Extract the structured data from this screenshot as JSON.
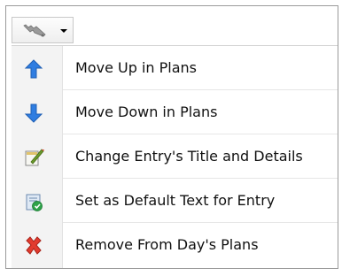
{
  "toolbar": {
    "button_icon": "wrench-icon",
    "dropdown_icon": "chevron-down-icon"
  },
  "menu": {
    "items": [
      {
        "label": "Move Up in Plans",
        "icon": "arrow-up-icon",
        "color": "#2f7de1"
      },
      {
        "label": "Move Down in Plans",
        "icon": "arrow-down-icon",
        "color": "#2f7de1"
      },
      {
        "label": "Change Entry's Title and Details",
        "icon": "edit-note-icon",
        "color": "#6a9a2a"
      },
      {
        "label": "Set as Default Text for Entry",
        "icon": "checked-document-icon",
        "color": "#2fa34a"
      },
      {
        "label": "Remove From Day's Plans",
        "icon": "red-x-icon",
        "color": "#e23b2e"
      }
    ]
  }
}
